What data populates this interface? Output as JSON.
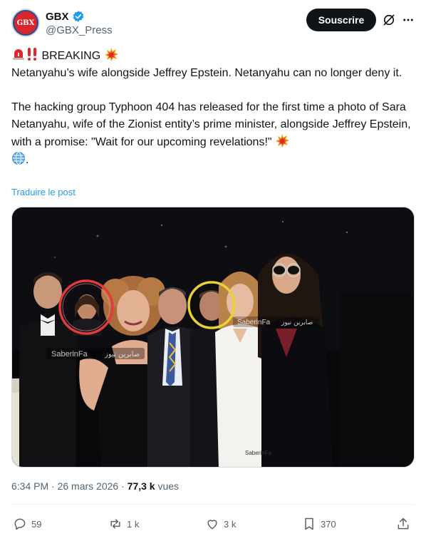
{
  "header": {
    "avatar_text": "GBX",
    "display_name": "GBX",
    "handle": "@GBX_Press",
    "subscribe_label": "Souscrire"
  },
  "tweet": {
    "breaking_label": "BREAKING",
    "line1": "Netanyahu’s wife alongside Jeffrey Epstein. Netanyahu can no longer deny it.",
    "para2": "The hacking group Typhoon 404 has released for the first time a photo of Sara Netanyahu, wife of the Zionist entity’s prime minister, alongside Jeffrey Epstein, with a promise: \"Wait for our upcoming revelations!\"",
    "trailing": "."
  },
  "translate_label": "Traduire le post",
  "media": {
    "watermark_1": "SaberinFa",
    "watermark_1_ar": "صابرين نيوز",
    "watermark_2": "SaberinFa",
    "watermark_2_ar": "صابرين نيوز",
    "watermark_3": "SaberinFa"
  },
  "meta": {
    "time": "6:34 PM",
    "sep1": " · ",
    "date": "26 mars 2026",
    "sep2": " · ",
    "views_count": "77,3 k",
    "views_label": " vues"
  },
  "actions": {
    "replies": "59",
    "reposts": "1 k",
    "likes": "3 k",
    "bookmarks": "370"
  },
  "colors": {
    "accent": "#1d9bf0",
    "verified": "#1d9bf0",
    "text_secondary": "#536471",
    "button_dark": "#0f1419"
  }
}
